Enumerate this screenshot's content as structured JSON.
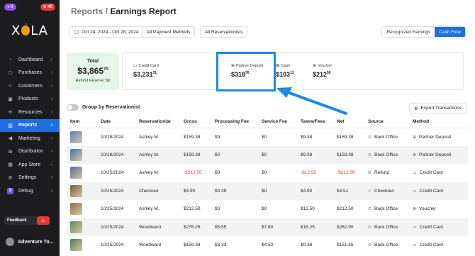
{
  "sidebar": {
    "badge_left": "0",
    "badge_right": "40",
    "logo": "XOLA",
    "items": [
      {
        "label": "Dashboard",
        "icon": "dashboard-icon"
      },
      {
        "label": "Purchases",
        "icon": "tag-icon"
      },
      {
        "label": "Customers",
        "icon": "user-icon"
      },
      {
        "label": "Products",
        "icon": "box-icon"
      },
      {
        "label": "Resources",
        "icon": "layers-icon"
      },
      {
        "label": "Reports",
        "icon": "chart-icon",
        "active": true
      },
      {
        "label": "Marketing",
        "icon": "megaphone-icon"
      },
      {
        "label": "Distribution",
        "icon": "distribution-icon"
      },
      {
        "label": "App Store",
        "icon": "store-icon"
      },
      {
        "label": "Settings",
        "icon": "gear-icon"
      },
      {
        "label": "Debug",
        "icon": "x-icon"
      }
    ],
    "feedback": "Feedback",
    "user": "Adventure To..."
  },
  "header": {
    "crumb": "Reports",
    "separator": " / ",
    "title": "Earnings Report"
  },
  "toolbar": {
    "date_range": "Oct 24, 2024 - Oct 28, 2024",
    "payment_methods": "All Payment Methods",
    "reservationists": "All Reservationists",
    "recognized": "Recognized Earnings",
    "cash_flow": "Cash Flow"
  },
  "summary": {
    "total_label": "Total",
    "total_main": "$3,865",
    "total_cents": "70",
    "refund_reserve": "Refund Reserve: $0",
    "methods": [
      {
        "label": "Credit Card",
        "main": "$3,231",
        "cents": "31"
      },
      {
        "label": "Partner Deposit",
        "main": "$318",
        "cents": "76"
      },
      {
        "label": "Cash",
        "main": "$103",
        "cents": "13"
      },
      {
        "label": "Voucher",
        "main": "$212",
        "cents": "50"
      }
    ]
  },
  "controls": {
    "group_toggle": "Group by Reservationist",
    "export": "Export Transactions"
  },
  "table": {
    "headers": [
      "Item",
      "Date",
      "Reservationist",
      "Gross",
      "Processing Fee",
      "Service Fee",
      "Taxes/Fees",
      "Net",
      "Source",
      "Method"
    ],
    "rows": [
      {
        "thumb": "#5a7fb8",
        "date": "10/28/2024",
        "res": "Ashley M.",
        "gross": "$159.38",
        "proc": "$0",
        "svc": "$0",
        "tax": "$9.38",
        "net": "$159.38",
        "source": "Back Office",
        "method": "Partner Deposit",
        "neg": false
      },
      {
        "thumb": "#4a6ea8",
        "date": "10/28/2024",
        "res": "Ashley M.",
        "gross": "$159.38",
        "proc": "$0",
        "svc": "$0",
        "tax": "$9.38",
        "net": "$159.38",
        "source": "Back Office",
        "method": "Partner Deposit",
        "neg": false
      },
      {
        "thumb": "#56679a",
        "date": "10/25/2024",
        "res": "Ashley M.",
        "gross": "-$212.50",
        "proc": "$0",
        "svc": "$0",
        "tax": "-$12.50",
        "net": "-$212.50",
        "source": "Refund",
        "method": "Credit Card",
        "neg": true
      },
      {
        "thumb": "#7a5a3a",
        "date": "10/25/2024",
        "res": "Checkout",
        "gross": "$4.90",
        "proc": "$0.39",
        "svc": "$0",
        "tax": "$4.90",
        "net": "$4.51",
        "source": "Checkout",
        "method": "Credit Card",
        "neg": false
      },
      {
        "thumb": "#8c6e4a",
        "date": "10/25/2024",
        "res": "Ashley M.",
        "gross": "$212.50",
        "proc": "$0",
        "svc": "$0",
        "tax": "$12.50",
        "net": "$212.50",
        "source": "Back Office",
        "method": "Voucher",
        "neg": false
      },
      {
        "thumb": "#5d8a56",
        "date": "10/25/2024",
        "res": "Woodward",
        "gross": "$276.25",
        "proc": "$5.55",
        "svc": "$7.80",
        "tax": "$16.25",
        "net": "$262.90",
        "source": "Back Office",
        "method": "Credit Card",
        "neg": false
      },
      {
        "thumb": "#4b7a5a",
        "date": "10/25/2024",
        "res": "Woodward",
        "gross": "$159.38",
        "proc": "$3.33",
        "svc": "$4.50",
        "tax": "$9.38",
        "net": "$151.55",
        "source": "Back Office",
        "method": "Credit Card",
        "neg": false
      }
    ]
  }
}
